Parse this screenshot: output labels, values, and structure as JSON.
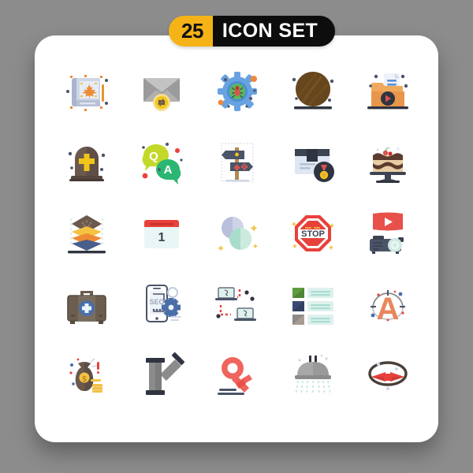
{
  "background_color": "#8c8c8c",
  "card": {
    "background_color": "#ffffff",
    "corner_radius": "26px"
  },
  "badge": {
    "count": "25",
    "label": "ICON SET",
    "count_bg": "#f5b317",
    "count_fg": "#111111",
    "label_bg": "#0d0d0d",
    "label_fg": "#ffffff"
  },
  "grid": {
    "columns": 5,
    "rows": 5,
    "total_icons": 25
  },
  "icons": [
    {
      "index": 1,
      "name": "book-maple-leaf-icon",
      "row": 1,
      "col": 1,
      "colors": [
        "#cfd6e6",
        "#aab4cc",
        "#ef8b33",
        "#e8932f"
      ]
    },
    {
      "index": 2,
      "name": "envelope-sync-icon",
      "row": 1,
      "col": 2,
      "colors": [
        "#9b9b9b",
        "#c3c3c3",
        "#f7dd8a",
        "#f0c419"
      ]
    },
    {
      "index": 3,
      "name": "gear-bug-icon",
      "row": 1,
      "col": 3,
      "colors": [
        "#68a2e0",
        "#4c8fd4",
        "#5cb85c",
        "#d9534f",
        "#f0883c"
      ]
    },
    {
      "index": 4,
      "name": "wooden-disc-icon",
      "row": 1,
      "col": 4,
      "colors": [
        "#6b4a1f",
        "#5a3d18",
        "#2f3440"
      ]
    },
    {
      "index": 5,
      "name": "folder-video-file-icon",
      "row": 1,
      "col": 5,
      "colors": [
        "#f0a95c",
        "#e8974a",
        "#eef2f8",
        "#2f3440",
        "#d9534f"
      ]
    },
    {
      "index": 6,
      "name": "tombstone-cross-icon",
      "row": 2,
      "col": 1,
      "colors": [
        "#6b594e",
        "#554640",
        "#f0c419"
      ]
    },
    {
      "index": 7,
      "name": "qa-chat-bubbles-icon",
      "row": 2,
      "col": 2,
      "colors": [
        "#c3d92a",
        "#2bb673",
        "#e8413c"
      ]
    },
    {
      "index": 8,
      "name": "signpost-direction-icon",
      "row": 2,
      "col": 3,
      "colors": [
        "#4a5468",
        "#b08a55",
        "#d9534f",
        "#f0c419"
      ]
    },
    {
      "index": 9,
      "name": "package-medal-icon",
      "row": 2,
      "col": 4,
      "colors": [
        "#dfe7f2",
        "#3d4351",
        "#2f3440",
        "#d9534f",
        "#f0c419"
      ]
    },
    {
      "index": 10,
      "name": "cake-stand-icon",
      "row": 2,
      "col": 5,
      "colors": [
        "#e8cda4",
        "#5b3c2e",
        "#3d4351",
        "#d9534f"
      ]
    },
    {
      "index": 11,
      "name": "stacked-layers-icon",
      "row": 3,
      "col": 1,
      "colors": [
        "#6b594e",
        "#f5c342",
        "#ef8b33",
        "#4a5e8c",
        "#2f3440"
      ]
    },
    {
      "index": 12,
      "name": "calendar-day-one-icon",
      "row": 3,
      "col": 2,
      "colors": [
        "#e8f6f5",
        "#e8413c",
        "#3d4351"
      ],
      "label": "1"
    },
    {
      "index": 13,
      "name": "two-pills-icon",
      "row": 3,
      "col": 3,
      "colors": [
        "#b9bfdd",
        "#cfd3e8",
        "#a9ddcb",
        "#cdeade",
        "#f5c342"
      ]
    },
    {
      "index": 14,
      "name": "stop-sign-icon",
      "row": 3,
      "col": 4,
      "colors": [
        "#e8413c",
        "#ffffff",
        "#3d4351",
        "#f5c342"
      ],
      "label": "STOP"
    },
    {
      "index": 15,
      "name": "video-projector-icon",
      "row": 3,
      "col": 5,
      "colors": [
        "#e8504a",
        "#ffffff",
        "#4a5468",
        "#cfe9e2"
      ]
    },
    {
      "index": 16,
      "name": "first-aid-kit-icon",
      "row": 4,
      "col": 1,
      "colors": [
        "#6b5e50",
        "#574b40",
        "#4a6ea8",
        "#eaf4fb"
      ]
    },
    {
      "index": 17,
      "name": "mobile-seo-gear-icon",
      "row": 4,
      "col": 2,
      "colors": [
        "#4a5468",
        "#4a6ea8",
        "#cfd6e6"
      ],
      "label": "SEO"
    },
    {
      "index": 18,
      "name": "laptop-network-icon",
      "row": 4,
      "col": 3,
      "colors": [
        "#dff1ec",
        "#4a5468",
        "#e8413c",
        "#2f3440"
      ]
    },
    {
      "index": 19,
      "name": "list-thumbnails-icon",
      "row": 4,
      "col": 4,
      "colors": [
        "#5d9c3f",
        "#3b4a73",
        "#8b8b8b",
        "#dff1ec"
      ]
    },
    {
      "index": 20,
      "name": "letter-a-typography-icon",
      "row": 4,
      "col": 5,
      "colors": [
        "#e8875c",
        "#8b8b8b",
        "#4a6ea8",
        "#e8413c"
      ],
      "label": "A"
    },
    {
      "index": 21,
      "name": "money-bag-coins-icon",
      "row": 5,
      "col": 1,
      "colors": [
        "#6b594e",
        "#554640",
        "#f5c342",
        "#e8a93c",
        "#e8413c"
      ]
    },
    {
      "index": 22,
      "name": "y-pipe-fitting-icon",
      "row": 5,
      "col": 2,
      "colors": [
        "#8b8b8b",
        "#6e6e6e",
        "#2f3440"
      ]
    },
    {
      "index": 23,
      "name": "female-gender-symbol-icon",
      "row": 5,
      "col": 3,
      "colors": [
        "#f0645e",
        "#e8504a",
        "#4a5468"
      ]
    },
    {
      "index": 24,
      "name": "shower-head-icon",
      "row": 5,
      "col": 4,
      "colors": [
        "#a8a8a8",
        "#8b8b8b",
        "#2f3440",
        "#cfe9e2"
      ]
    },
    {
      "index": 25,
      "name": "bow-tie-collar-icon",
      "row": 5,
      "col": 5,
      "colors": [
        "#e8413c",
        "#d13a34",
        "#4a4038",
        "#cfd6e6"
      ]
    }
  ]
}
